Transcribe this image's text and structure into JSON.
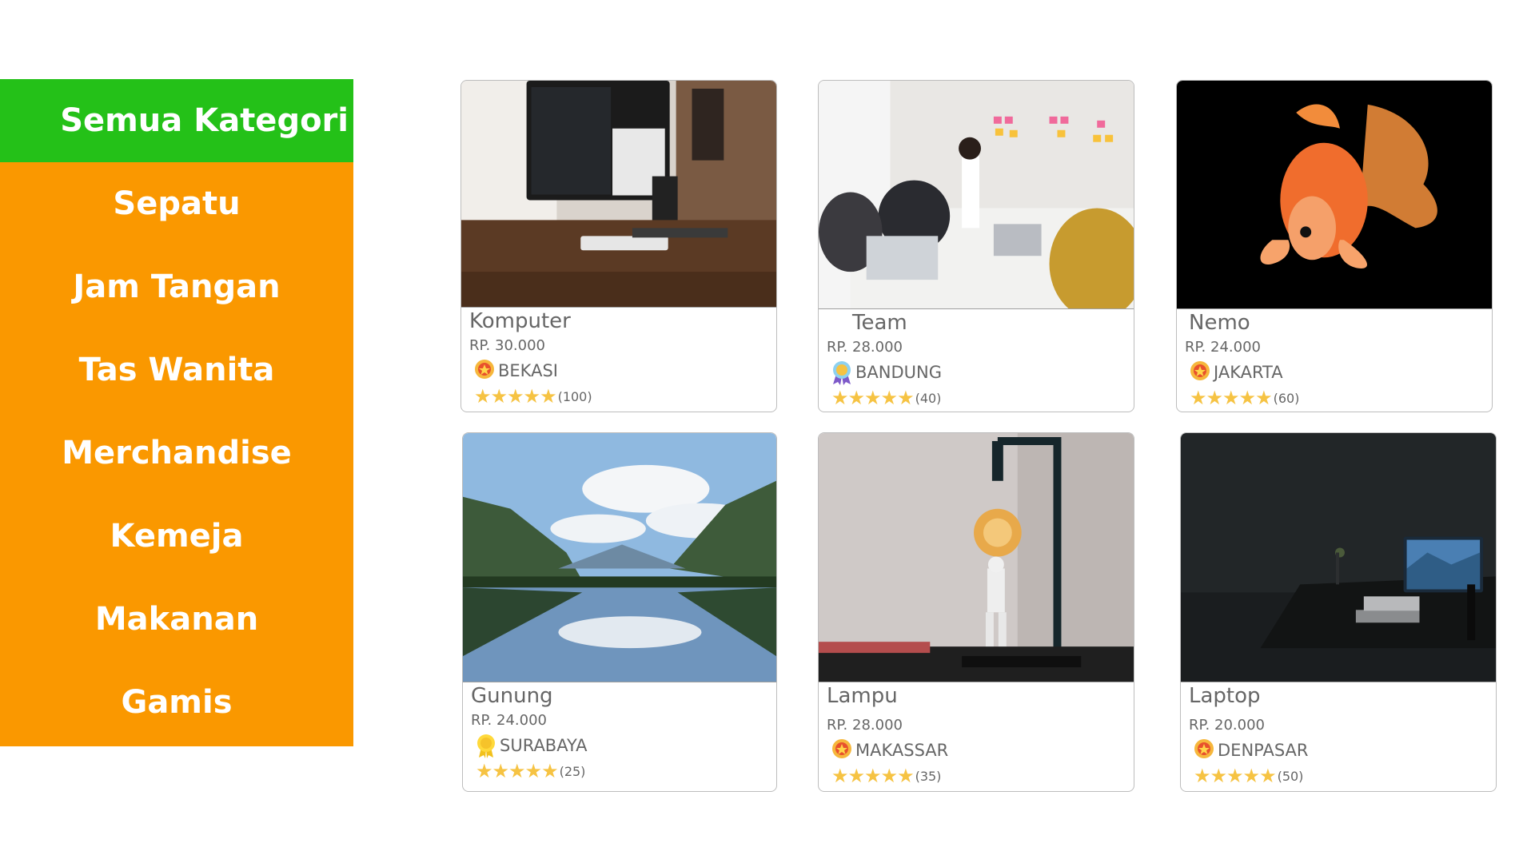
{
  "sidebar": {
    "items": [
      {
        "label": "Semua Kategori",
        "active": true
      },
      {
        "label": "Sepatu"
      },
      {
        "label": "Jam Tangan"
      },
      {
        "label": "Tas Wanita"
      },
      {
        "label": "Merchandise"
      },
      {
        "label": "Kemeja"
      },
      {
        "label": "Makanan"
      },
      {
        "label": "Gamis"
      }
    ],
    "color": "#fa9800",
    "active_color": "#24c118"
  },
  "products": [
    {
      "name": "Komputer",
      "price": "RP. 30.000",
      "location": "BEKASI",
      "stars": "★★★★★",
      "count": "(100)",
      "image": "desk-computer-photo"
    },
    {
      "name": "Team",
      "price": "RP. 28.000",
      "location": "BANDUNG",
      "stars": "★★★★★",
      "count": "(40)",
      "image": "team-meeting-photo"
    },
    {
      "name": "Nemo",
      "price": "RP. 24.000",
      "location": "JAKARTA",
      "stars": "★★★★★",
      "count": "(60)",
      "image": "goldfish-photo"
    },
    {
      "name": "Gunung",
      "price": "RP. 24.000",
      "location": "SURABAYA",
      "stars": "★★★★★",
      "count": "(25)",
      "image": "mountain-lake-photo"
    },
    {
      "name": "Lampu",
      "price": "RP. 28.000",
      "location": "MAKASSAR",
      "stars": "★★★★★",
      "count": "(35)",
      "image": "lamp-figure-photo"
    },
    {
      "name": "Laptop",
      "price": "RP. 20.000",
      "location": "DENPASAR",
      "stars": "★★★★★",
      "count": "(50)",
      "image": "dark-desk-laptop-photo"
    }
  ]
}
